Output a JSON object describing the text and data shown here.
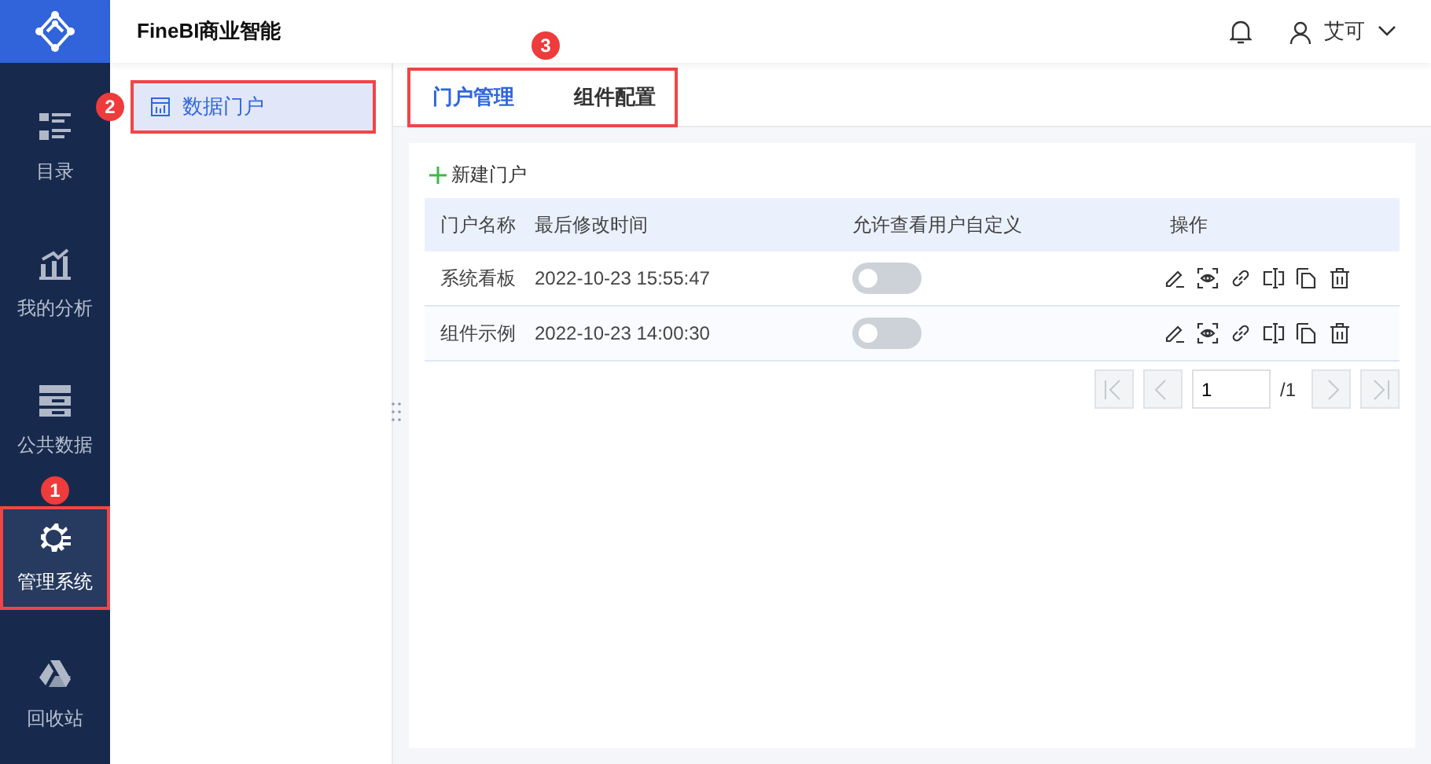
{
  "app": {
    "title": "FineBI商业智能"
  },
  "header": {
    "user": "艾可"
  },
  "sidebar": {
    "items": [
      {
        "kind": "catalog",
        "label": "目录",
        "selected": false
      },
      {
        "kind": "analysis",
        "label": "我的分析",
        "selected": false
      },
      {
        "kind": "data",
        "label": "公共数据",
        "selected": false
      },
      {
        "kind": "admin",
        "label": "管理系统",
        "selected": true,
        "callout": "1"
      },
      {
        "kind": "trash",
        "label": "回收站",
        "selected": false
      }
    ]
  },
  "subnav": {
    "items": [
      {
        "label": "数据门户",
        "selected": true,
        "callout": "2"
      }
    ]
  },
  "tabs": {
    "callout": "3",
    "items": [
      {
        "label": "门户管理",
        "selected": true
      },
      {
        "label": "组件配置",
        "selected": false
      }
    ]
  },
  "toolbar": {
    "new_button": "新建门户"
  },
  "table": {
    "columns": [
      "门户名称",
      "最后修改时间",
      "允许查看用户自定义",
      "操作"
    ],
    "rows": [
      {
        "name": "系统看板",
        "modified": "2022-10-23 15:55:47",
        "allow_custom": false
      },
      {
        "name": "组件示例",
        "modified": "2022-10-23 14:00:30",
        "allow_custom": false
      }
    ]
  },
  "pagination": {
    "page": "1",
    "total": "/1"
  }
}
